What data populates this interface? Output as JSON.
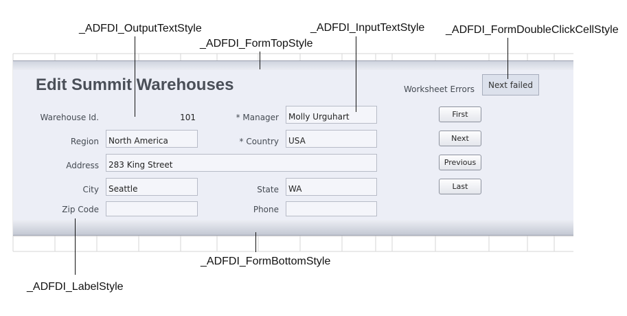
{
  "form": {
    "title": "Edit Summit Warehouses",
    "worksheet_errors_label": "Worksheet Errors",
    "next_failed_label": "Next failed",
    "fields": {
      "warehouse_id": {
        "label": "Warehouse Id.",
        "value": "101"
      },
      "manager": {
        "label": "* Manager",
        "value": "Molly Urguhart"
      },
      "region": {
        "label": "Region",
        "value": "North America"
      },
      "country": {
        "label": "* Country",
        "value": "USA"
      },
      "address": {
        "label": "Address",
        "value": "283 King Street"
      },
      "city": {
        "label": "City",
        "value": "Seattle"
      },
      "state": {
        "label": "State",
        "value": "WA"
      },
      "zip_code": {
        "label": "Zip Code",
        "value": ""
      },
      "phone": {
        "label": "Phone",
        "value": ""
      }
    },
    "nav_buttons": {
      "first": "First",
      "next": "Next",
      "previous": "Previous",
      "last": "Last"
    }
  },
  "callouts": {
    "output_text_style": "_ADFDI_OutputTextStyle",
    "form_top_style": "_ADFDI_FormTopStyle",
    "input_text_style": "_ADFDI_InputTextStyle",
    "form_double_click_cell_style": "_ADFDI_FormDoubleClickCellStyle",
    "form_bottom_style": "_ADFDI_FormBottomStyle",
    "label_style": "_ADFDI_LabelStyle"
  },
  "colors": {
    "form_background": "#eceef6",
    "grid_line": "#d4d4d4",
    "title_text": "#4a4f58"
  }
}
